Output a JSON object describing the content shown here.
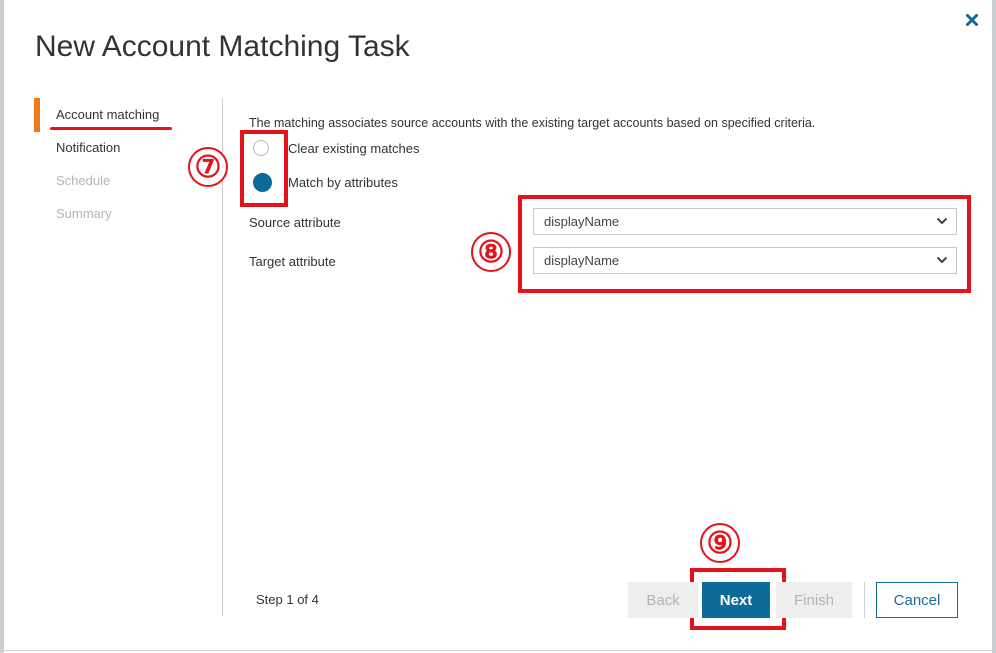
{
  "dialog": {
    "title": "New Account Matching Task",
    "close_icon": "close-icon"
  },
  "nav": {
    "items": [
      {
        "label": "Account matching",
        "state": "active"
      },
      {
        "label": "Notification",
        "state": "enabled"
      },
      {
        "label": "Schedule",
        "state": "disabled"
      },
      {
        "label": "Summary",
        "state": "disabled"
      }
    ]
  },
  "content": {
    "intro": "The matching associates source accounts with the existing target accounts based on specified criteria.",
    "options": [
      {
        "label": "Clear existing matches",
        "checked": false
      },
      {
        "label": "Match by attributes",
        "checked": true
      }
    ],
    "source_attribute": {
      "label": "Source attribute",
      "value": "displayName"
    },
    "target_attribute": {
      "label": "Target attribute",
      "value": "displayName"
    }
  },
  "footer": {
    "step": "Step 1 of 4",
    "back": "Back",
    "next": "Next",
    "finish": "Finish",
    "cancel": "Cancel"
  },
  "annotations": {
    "n7": "⑦",
    "n8": "⑧",
    "n9": "⑨",
    "color": "#e3131b"
  },
  "colors": {
    "accent": "#0e6b99",
    "active_nav_bar": "#ec7a1c"
  }
}
